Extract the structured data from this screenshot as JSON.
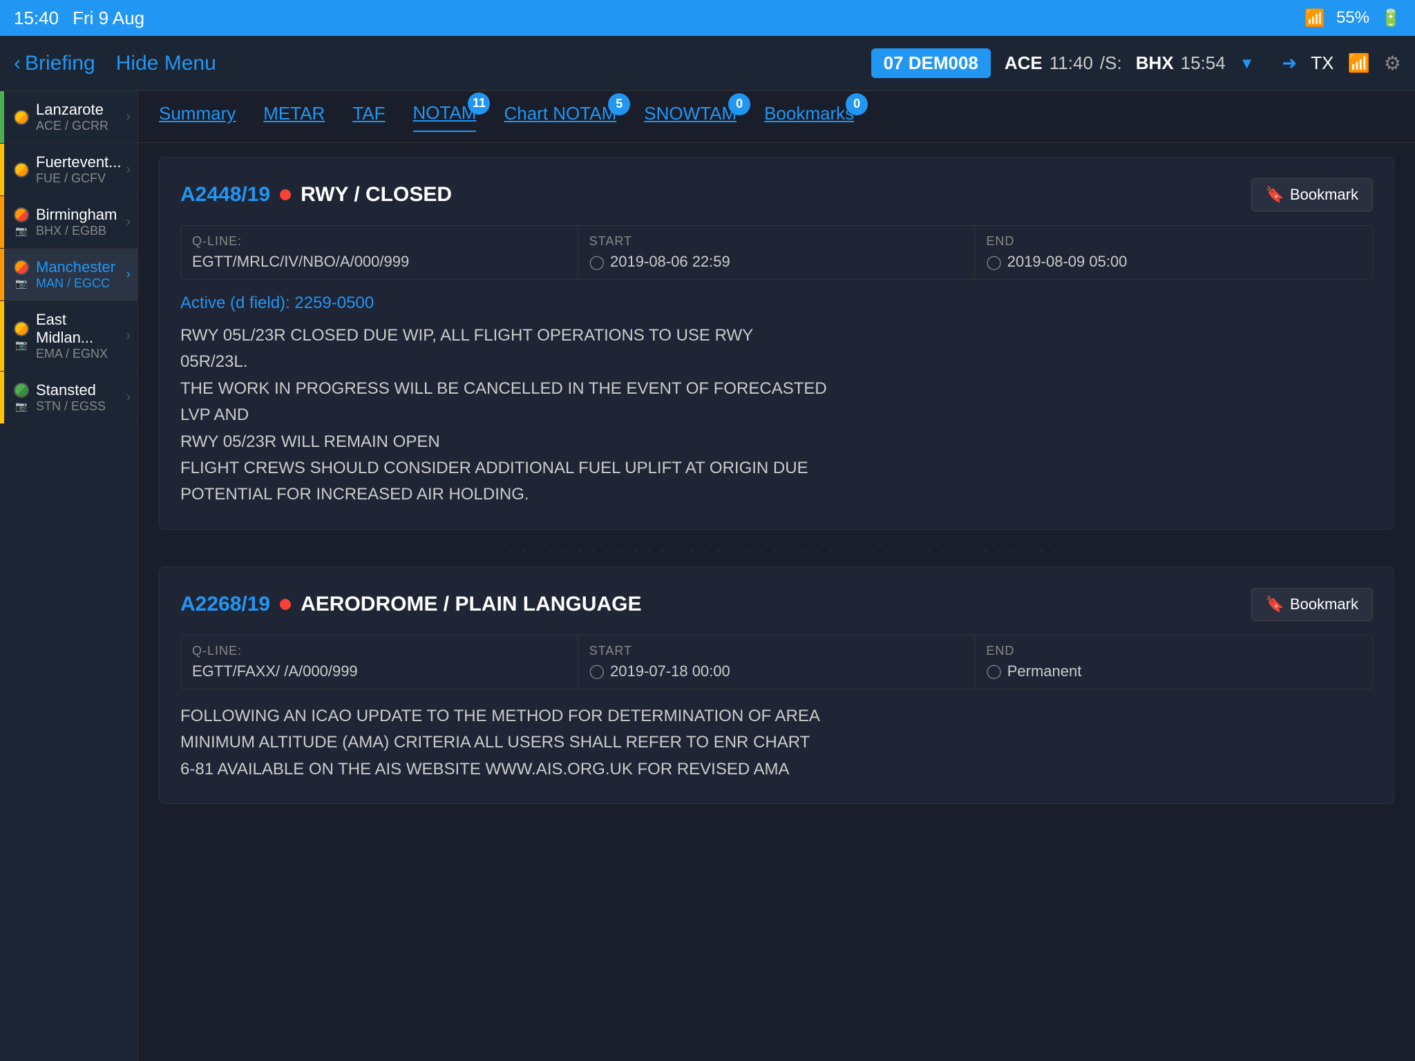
{
  "status_bar": {
    "time": "15:40",
    "day": "Fri 9 Aug",
    "wifi_icon": "wifi",
    "battery": "55%"
  },
  "header": {
    "back_label": "Briefing",
    "hide_menu_label": "Hide Menu",
    "flight_badge": "07 DEM008",
    "seg1_airport": "ACE",
    "seg1_time": "11:40",
    "sep": "/S:",
    "seg2_airport": "BHX",
    "seg2_time": "15:54",
    "tx_label": "TX",
    "icons": [
      "share-icon",
      "wifi-icon",
      "gear-icon"
    ]
  },
  "sidebar": {
    "items": [
      {
        "name": "Lanzarote",
        "code": "ACE / GCRR",
        "indicator_color": "#4CAF50",
        "status": "yellow",
        "has_camera": false
      },
      {
        "name": "Fuertevent...",
        "code": "FUE / GCFV",
        "indicator_color": "#FFC107",
        "status": "yellow",
        "has_camera": false
      },
      {
        "name": "Birmingham",
        "code": "BHX / EGBB",
        "indicator_color": "#FF9800",
        "status": "orange",
        "has_camera": true
      },
      {
        "name": "Manchester",
        "code": "MAN / EGCC",
        "indicator_color": "#FF9800",
        "status": "orange",
        "has_camera": true,
        "active": true
      },
      {
        "name": "East Midlan...",
        "code": "EMA / EGNX",
        "indicator_color": "#FFC107",
        "status": "yellow",
        "has_camera": true
      },
      {
        "name": "Stansted",
        "code": "STN / EGSS",
        "indicator_color": "#FFC107",
        "status": "green",
        "has_camera": true
      }
    ]
  },
  "tabs": [
    {
      "label": "Summary",
      "badge": null,
      "active": false
    },
    {
      "label": "METAR",
      "badge": null,
      "active": false
    },
    {
      "label": "TAF",
      "badge": null,
      "active": false
    },
    {
      "label": "NOTAM",
      "badge": "11",
      "active": true
    },
    {
      "label": "Chart NOTAM",
      "badge": "5",
      "active": false
    },
    {
      "label": "SNOWTAM",
      "badge": "0",
      "active": false
    },
    {
      "label": "Bookmarks",
      "badge": "0",
      "active": false
    }
  ],
  "notams": [
    {
      "id": "A2448/19",
      "type": "RWY / CLOSED",
      "q_line_label": "Q-LINE:",
      "q_line_value": "EGTT/MRLC/IV/NBO/A/000/999",
      "start_label": "START",
      "start_value": "2019-08-06 22:59",
      "end_label": "END",
      "end_value": "2019-08-09 05:00",
      "active_label": "Active (d field):",
      "active_value": "2259-0500",
      "body": "RWY 05L/23R CLOSED DUE WIP, ALL FLIGHT OPERATIONS TO USE RWY\n05R/23L.\nTHE WORK IN PROGRESS WILL BE CANCELLED IN THE EVENT OF FORECASTED\nLVP AND\nRWY 05/23R WILL REMAIN OPEN\nFLIGHT CREWS SHOULD CONSIDER ADDITIONAL FUEL UPLIFT AT ORIGIN DUE\nPOTENTIAL FOR INCREASED AIR HOLDING.",
      "bookmark_label": "Bookmark"
    },
    {
      "id": "A2268/19",
      "type": "AERODROME / PLAIN LANGUAGE",
      "q_line_label": "Q-LINE:",
      "q_line_value": "EGTT/FAXX/ /A/000/999",
      "start_label": "START",
      "start_value": "2019-07-18 00:00",
      "end_label": "END",
      "end_value": "Permanent",
      "active_label": null,
      "active_value": null,
      "body": "FOLLOWING AN ICAO UPDATE TO THE METHOD FOR DETERMINATION OF AREA\nMINIMUM ALTITUDE (AMA) CRITERIA ALL USERS SHALL REFER TO ENR CHART\n6-81 AVAILABLE ON THE AIS WEBSITE WWW.AIS.ORG.UK FOR REVISED AMA",
      "bookmark_label": "Bookmark"
    }
  ]
}
